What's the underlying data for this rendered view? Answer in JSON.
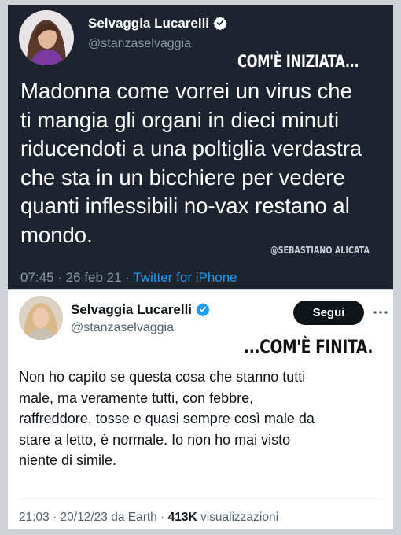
{
  "top_tweet": {
    "author_name": "Selvaggia Lucarelli",
    "handle": "@stanzaselvaggia",
    "caption": "COM'È INIZIATA...",
    "body_lines": [
      "Madonna come vorrei un virus che",
      "ti mangia gli organi in dieci minuti",
      "riducendoti a una poltiglia verdastra",
      "che sta in un bicchiere per vedere",
      "quanti inflessibili no-vax restano al",
      "mondo."
    ],
    "watermark": "@SEBASTIANO ALICATA",
    "meta_time": "07:45 · 26 feb 21 · ",
    "meta_source": "Twitter for iPhone",
    "colors": {
      "background": "#1d2430",
      "link": "#1d9bf0",
      "verified": "#1d9bf0"
    }
  },
  "bottom_tweet": {
    "author_name": "Selvaggia Lucarelli",
    "handle": "@stanzaselvaggia",
    "follow_label": "Segui",
    "more_icon": "more-horizontal-icon",
    "caption": "...COM'È FINITA.",
    "body_lines": [
      "Non ho capito se questa cosa che stanno tutti",
      "male, ma veramente tutti, con febbre,",
      "raffreddore, tosse e quasi sempre così male da",
      "stare a letto,  è normale. Io non ho mai visto",
      "niente di simile."
    ],
    "meta_time": "21:03 · 20/12/23 da Earth · ",
    "meta_count": "413K",
    "meta_views": " visualizzazioni",
    "colors": {
      "background": "#ffffff",
      "button": "#0f1419",
      "verified": "#1d9bf0"
    }
  }
}
